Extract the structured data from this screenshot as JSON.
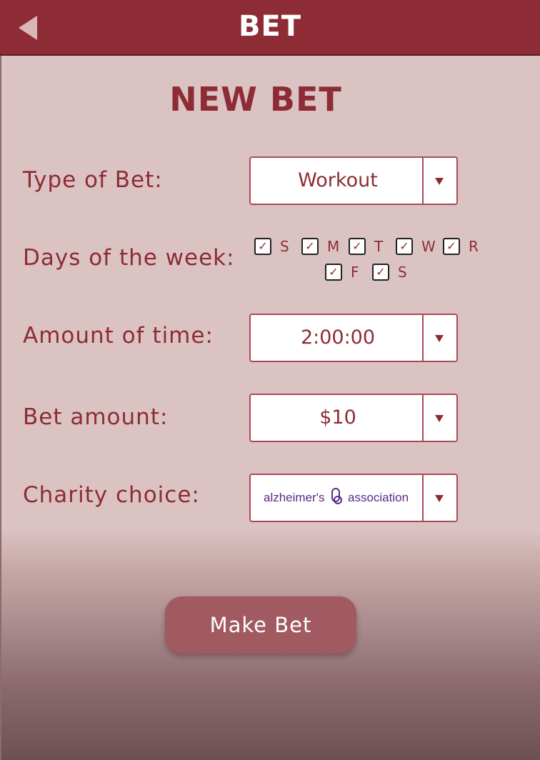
{
  "header": {
    "title": "BET",
    "back_icon": "back-arrow-icon"
  },
  "page_title": "NEW BET",
  "fields": {
    "type_label": "Type of Bet:",
    "type_value": "Workout",
    "days_label": "Days of the week:",
    "days": [
      {
        "letter": "S",
        "checked": true
      },
      {
        "letter": "M",
        "checked": true
      },
      {
        "letter": "T",
        "checked": true
      },
      {
        "letter": "W",
        "checked": true
      },
      {
        "letter": "R",
        "checked": true
      },
      {
        "letter": "F",
        "checked": true
      },
      {
        "letter": "S",
        "checked": true
      }
    ],
    "time_label": "Amount of time:",
    "time_value": "2:00:00",
    "amount_label": "Bet amount:",
    "amount_value": "$10",
    "charity_label": "Charity choice:",
    "charity_value": "alzheimer's association"
  },
  "submit_label": "Make Bet",
  "colors": {
    "primary": "#8e2c35",
    "background": "#dbc3c3",
    "button": "#a05a60",
    "charity_logo": "#5b2a86"
  }
}
